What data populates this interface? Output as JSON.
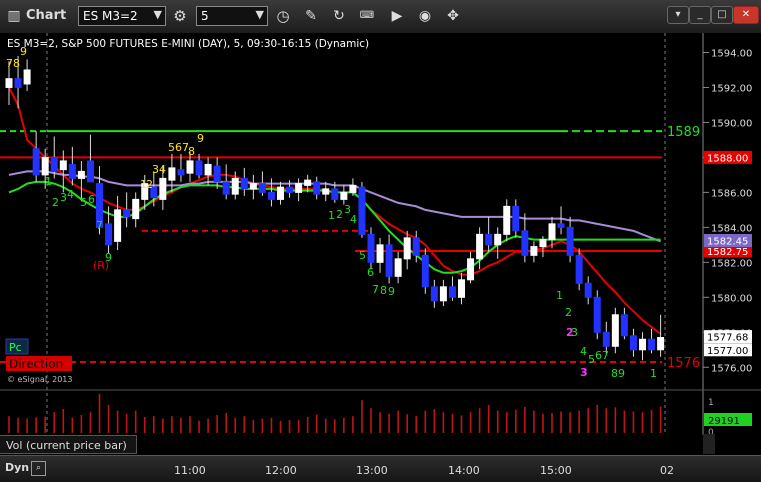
{
  "app": {
    "title": "Chart",
    "symbol": "ES M3=2",
    "interval": "5"
  },
  "chart_title": "ES M3=2, S&P 500 FUTURES E-MINI (DAY), 5, 09:30-16:15 (Dynamic)",
  "copyright": "© eSignal, 2013",
  "price_axis": {
    "ticks": [
      "1594.00",
      "1592.00",
      "1590.00",
      "1588.00",
      "1586.00",
      "1584.00",
      "1582.00",
      "1580.00",
      "1578.00",
      "1576.00"
    ]
  },
  "price_badges": [
    {
      "label": "1588.00",
      "color": "#e60000",
      "value": 1588.0
    },
    {
      "label": "1582.75",
      "color": "#e60000",
      "value": 1582.65
    },
    {
      "label": "1582.45",
      "color": "#7b68c6",
      "value": 1583.25
    },
    {
      "label": "1577.68",
      "color": "#ffffff",
      "value": 1577.75
    },
    {
      "label": "1577.00",
      "color": "#ffffff",
      "value": 1577.0
    }
  ],
  "level_labels": [
    {
      "label": "1589",
      "color": "#22dd22",
      "value": 1589.5
    },
    {
      "label": "1576",
      "color": "#e60000",
      "value": 1576.3
    }
  ],
  "time_axis": {
    "ticks": [
      "11:00",
      "12:00",
      "13:00",
      "14:00",
      "15:00",
      "02"
    ]
  },
  "indicators": {
    "pc": "Pc",
    "direction": "Direction",
    "bottom_tag": "Dyn"
  },
  "counts": {
    "yellow": [
      "78",
      "9",
      "1",
      "2",
      "34",
      "567",
      "8",
      "9"
    ],
    "green": [
      "1",
      "2",
      "3",
      "4",
      "5",
      "6",
      "7",
      "8",
      "9",
      "1",
      "2",
      "3",
      "4",
      "5",
      "6",
      "7",
      "8",
      "9",
      "1",
      "2",
      "3",
      "4",
      "5",
      "6",
      "7",
      "8",
      "9",
      "1"
    ],
    "magenta": [
      "1",
      "2",
      "3"
    ],
    "red": [
      "(R)"
    ]
  },
  "volume": {
    "label": "Vol (current price bar)",
    "value_label": "29191",
    "axis_ticks": [
      "1",
      "0"
    ]
  },
  "chart_data": {
    "type": "candlestick",
    "title": "ES M3=2, S&P 500 FUTURES E-MINI (DAY), 5, 09:30-16:15 (Dynamic)",
    "y_range": [
      1575.5,
      1595.0
    ],
    "x_labels": [
      "11:00",
      "12:00",
      "13:00",
      "14:00",
      "15:00",
      "02"
    ],
    "candles": [
      {
        "o": 1592.0,
        "h": 1593.5,
        "l": 1591.0,
        "c": 1592.5
      },
      {
        "o": 1592.5,
        "h": 1593.8,
        "l": 1590.8,
        "c": 1592.0
      },
      {
        "o": 1592.2,
        "h": 1593.6,
        "l": 1591.8,
        "c": 1593.0
      },
      {
        "o": 1588.5,
        "h": 1589.5,
        "l": 1586.6,
        "c": 1587.0
      },
      {
        "o": 1587.0,
        "h": 1588.5,
        "l": 1586.2,
        "c": 1588.0
      },
      {
        "o": 1588.0,
        "h": 1589.2,
        "l": 1586.8,
        "c": 1587.2
      },
      {
        "o": 1587.3,
        "h": 1588.4,
        "l": 1586.0,
        "c": 1587.8
      },
      {
        "o": 1587.6,
        "h": 1588.6,
        "l": 1586.4,
        "c": 1586.8
      },
      {
        "o": 1586.8,
        "h": 1587.8,
        "l": 1585.5,
        "c": 1587.2
      },
      {
        "o": 1587.8,
        "h": 1589.3,
        "l": 1586.8,
        "c": 1586.6
      },
      {
        "o": 1586.5,
        "h": 1587.5,
        "l": 1583.6,
        "c": 1584.0
      },
      {
        "o": 1584.2,
        "h": 1585.2,
        "l": 1582.5,
        "c": 1583.0
      },
      {
        "o": 1583.2,
        "h": 1585.8,
        "l": 1582.7,
        "c": 1585.0
      },
      {
        "o": 1585.0,
        "h": 1586.0,
        "l": 1584.0,
        "c": 1584.6
      },
      {
        "o": 1584.5,
        "h": 1586.0,
        "l": 1584.0,
        "c": 1585.6
      },
      {
        "o": 1585.6,
        "h": 1587.0,
        "l": 1585.0,
        "c": 1586.5
      },
      {
        "o": 1586.3,
        "h": 1587.2,
        "l": 1585.2,
        "c": 1585.7
      },
      {
        "o": 1585.6,
        "h": 1587.5,
        "l": 1585.0,
        "c": 1586.8
      },
      {
        "o": 1586.7,
        "h": 1588.2,
        "l": 1586.0,
        "c": 1587.4
      },
      {
        "o": 1587.3,
        "h": 1588.2,
        "l": 1586.6,
        "c": 1587.0
      },
      {
        "o": 1587.1,
        "h": 1588.3,
        "l": 1586.6,
        "c": 1587.8
      },
      {
        "o": 1587.8,
        "h": 1588.2,
        "l": 1586.8,
        "c": 1587.0
      },
      {
        "o": 1587.0,
        "h": 1588.0,
        "l": 1586.4,
        "c": 1587.6
      },
      {
        "o": 1587.5,
        "h": 1588.0,
        "l": 1586.2,
        "c": 1586.6
      },
      {
        "o": 1586.6,
        "h": 1587.6,
        "l": 1585.6,
        "c": 1585.9
      },
      {
        "o": 1585.9,
        "h": 1587.2,
        "l": 1585.6,
        "c": 1586.8
      },
      {
        "o": 1586.8,
        "h": 1587.4,
        "l": 1585.8,
        "c": 1586.2
      },
      {
        "o": 1586.2,
        "h": 1587.0,
        "l": 1585.6,
        "c": 1586.5
      },
      {
        "o": 1586.5,
        "h": 1587.2,
        "l": 1585.8,
        "c": 1586.0
      },
      {
        "o": 1586.0,
        "h": 1586.8,
        "l": 1585.2,
        "c": 1585.6
      },
      {
        "o": 1585.6,
        "h": 1586.6,
        "l": 1585.3,
        "c": 1586.3
      },
      {
        "o": 1586.3,
        "h": 1586.7,
        "l": 1585.7,
        "c": 1586.0
      },
      {
        "o": 1586.0,
        "h": 1586.8,
        "l": 1585.5,
        "c": 1586.5
      },
      {
        "o": 1586.4,
        "h": 1587.0,
        "l": 1586.0,
        "c": 1586.7
      },
      {
        "o": 1586.6,
        "h": 1586.9,
        "l": 1585.6,
        "c": 1585.9
      },
      {
        "o": 1585.9,
        "h": 1586.6,
        "l": 1585.5,
        "c": 1586.2
      },
      {
        "o": 1586.2,
        "h": 1586.6,
        "l": 1585.4,
        "c": 1585.6
      },
      {
        "o": 1585.6,
        "h": 1586.4,
        "l": 1585.3,
        "c": 1586.0
      },
      {
        "o": 1586.0,
        "h": 1586.8,
        "l": 1585.8,
        "c": 1586.4
      },
      {
        "o": 1586.3,
        "h": 1586.6,
        "l": 1583.4,
        "c": 1583.6
      },
      {
        "o": 1583.6,
        "h": 1584.0,
        "l": 1581.6,
        "c": 1582.0
      },
      {
        "o": 1582.0,
        "h": 1583.4,
        "l": 1581.4,
        "c": 1583.0
      },
      {
        "o": 1583.0,
        "h": 1583.6,
        "l": 1580.8,
        "c": 1581.2
      },
      {
        "o": 1581.2,
        "h": 1582.6,
        "l": 1580.8,
        "c": 1582.2
      },
      {
        "o": 1582.2,
        "h": 1583.8,
        "l": 1581.6,
        "c": 1583.4
      },
      {
        "o": 1583.4,
        "h": 1583.8,
        "l": 1582.0,
        "c": 1582.4
      },
      {
        "o": 1582.4,
        "h": 1582.8,
        "l": 1580.2,
        "c": 1580.6
      },
      {
        "o": 1580.6,
        "h": 1581.0,
        "l": 1579.4,
        "c": 1579.8
      },
      {
        "o": 1579.8,
        "h": 1581.0,
        "l": 1579.5,
        "c": 1580.6
      },
      {
        "o": 1580.6,
        "h": 1581.2,
        "l": 1579.8,
        "c": 1580.0
      },
      {
        "o": 1580.0,
        "h": 1581.4,
        "l": 1579.6,
        "c": 1581.0
      },
      {
        "o": 1581.0,
        "h": 1582.6,
        "l": 1580.8,
        "c": 1582.2
      },
      {
        "o": 1582.2,
        "h": 1584.0,
        "l": 1581.6,
        "c": 1583.6
      },
      {
        "o": 1583.6,
        "h": 1584.6,
        "l": 1582.6,
        "c": 1583.0
      },
      {
        "o": 1583.0,
        "h": 1584.0,
        "l": 1582.2,
        "c": 1583.6
      },
      {
        "o": 1583.6,
        "h": 1585.6,
        "l": 1583.2,
        "c": 1585.2
      },
      {
        "o": 1585.2,
        "h": 1585.6,
        "l": 1583.4,
        "c": 1583.8
      },
      {
        "o": 1583.8,
        "h": 1584.8,
        "l": 1582.0,
        "c": 1582.4
      },
      {
        "o": 1582.4,
        "h": 1583.2,
        "l": 1582.0,
        "c": 1582.9
      },
      {
        "o": 1582.9,
        "h": 1583.5,
        "l": 1582.3,
        "c": 1583.3
      },
      {
        "o": 1583.3,
        "h": 1584.6,
        "l": 1582.8,
        "c": 1584.2
      },
      {
        "o": 1584.2,
        "h": 1585.2,
        "l": 1583.6,
        "c": 1584.0
      },
      {
        "o": 1584.0,
        "h": 1584.6,
        "l": 1582.0,
        "c": 1582.4
      },
      {
        "o": 1582.4,
        "h": 1582.8,
        "l": 1580.4,
        "c": 1580.8
      },
      {
        "o": 1580.8,
        "h": 1581.2,
        "l": 1579.6,
        "c": 1580.0
      },
      {
        "o": 1580.0,
        "h": 1580.4,
        "l": 1577.6,
        "c": 1578.0
      },
      {
        "o": 1578.0,
        "h": 1578.6,
        "l": 1576.8,
        "c": 1577.2
      },
      {
        "o": 1577.2,
        "h": 1579.4,
        "l": 1576.8,
        "c": 1579.0
      },
      {
        "o": 1579.0,
        "h": 1579.4,
        "l": 1577.6,
        "c": 1577.8
      },
      {
        "o": 1577.8,
        "h": 1578.2,
        "l": 1576.6,
        "c": 1577.0
      },
      {
        "o": 1577.0,
        "h": 1578.0,
        "l": 1576.4,
        "c": 1577.6
      },
      {
        "o": 1577.6,
        "h": 1578.2,
        "l": 1576.8,
        "c": 1577.0
      },
      {
        "o": 1577.0,
        "h": 1579.0,
        "l": 1576.6,
        "c": 1577.7
      }
    ],
    "lines": [
      {
        "color": "#e60000",
        "values": [
          1592.0,
          1591.0,
          1589.0,
          1588.5,
          1588.0,
          1587.5,
          1587.0,
          1586.5,
          1586.2,
          1586.0,
          1585.7,
          1585.4,
          1585.2,
          1585.0,
          1585.0,
          1585.2,
          1585.5,
          1585.8,
          1586.0,
          1586.3,
          1586.5,
          1586.7,
          1586.9,
          1587.0,
          1587.0,
          1586.9,
          1586.7,
          1586.5,
          1586.4,
          1586.3,
          1586.2,
          1586.2,
          1586.2,
          1586.2,
          1586.2,
          1586.1,
          1586.0,
          1586.0,
          1586.0,
          1585.6,
          1585.0,
          1584.6,
          1584.2,
          1583.9,
          1583.6,
          1583.4,
          1583.0,
          1582.4,
          1581.8,
          1581.5,
          1581.3,
          1581.3,
          1581.5,
          1581.8,
          1582.0,
          1582.3,
          1582.6,
          1582.6,
          1582.7,
          1582.8,
          1583.0,
          1583.2,
          1583.0,
          1582.6,
          1582.0,
          1581.4,
          1580.8,
          1580.3,
          1579.7,
          1579.2,
          1578.7,
          1578.3,
          1577.9
        ]
      },
      {
        "color": "#a98bd8",
        "values": [
          1587.0,
          1587.1,
          1587.2,
          1587.2,
          1587.2,
          1587.1,
          1587.0,
          1587.0,
          1586.9,
          1586.9,
          1586.8,
          1586.6,
          1586.5,
          1586.4,
          1586.4,
          1586.4,
          1586.4,
          1586.4,
          1586.4,
          1586.4,
          1586.5,
          1586.5,
          1586.6,
          1586.6,
          1586.6,
          1586.6,
          1586.6,
          1586.5,
          1586.5,
          1586.5,
          1586.5,
          1586.5,
          1586.5,
          1586.5,
          1586.5,
          1586.5,
          1586.4,
          1586.4,
          1586.4,
          1586.2,
          1586.0,
          1585.8,
          1585.6,
          1585.4,
          1585.3,
          1585.2,
          1585.0,
          1584.9,
          1584.8,
          1584.7,
          1584.6,
          1584.6,
          1584.6,
          1584.6,
          1584.6,
          1584.6,
          1584.6,
          1584.5,
          1584.5,
          1584.5,
          1584.5,
          1584.5,
          1584.4,
          1584.4,
          1584.3,
          1584.2,
          1584.1,
          1584.0,
          1583.9,
          1583.8,
          1583.6,
          1583.4,
          1583.2
        ]
      },
      {
        "color": "#22dd22",
        "values": [
          1586.0,
          1586.2,
          1586.5,
          1586.6,
          1586.6,
          1586.5,
          1586.3,
          1586.0,
          1585.6,
          1585.3,
          1585.0,
          1584.8,
          1584.6,
          1584.6,
          1584.8,
          1585.2,
          1585.6,
          1585.9,
          1586.1,
          1586.3,
          1586.4,
          1586.4,
          1586.4,
          1586.4,
          1586.3,
          1586.3,
          1586.2,
          1586.2,
          1586.2,
          1586.2,
          1586.1,
          1586.1,
          1586.1,
          1586.1,
          1586.1,
          1586.1,
          1586.0,
          1586.0,
          1586.0,
          1585.6,
          1585.0,
          1584.4,
          1583.8,
          1583.3,
          1582.8,
          1582.4,
          1582.0,
          1581.6,
          1581.4,
          1581.4,
          1581.5,
          1581.7,
          1582.1,
          1582.6,
          1583.0,
          1583.3,
          1583.5,
          1583.4,
          1583.3,
          1583.3,
          1583.3,
          1583.3,
          1583.3,
          1583.3,
          1583.3,
          1583.3,
          1583.3,
          1583.3,
          1583.3,
          1583.3,
          1583.3,
          1583.3,
          1583.3
        ]
      }
    ],
    "levels": [
      {
        "value": 1589.5,
        "color": "#22dd22",
        "style": "dashed-then-solid"
      },
      {
        "value": 1588.0,
        "color": "#e60000",
        "style": "solid"
      },
      {
        "value": 1583.8,
        "color": "#e60000",
        "style": "dashed"
      },
      {
        "value": 1582.65,
        "color": "#e60000",
        "style": "solid"
      },
      {
        "value": 1576.3,
        "color": "#e60000",
        "style": "dashed"
      }
    ],
    "volume": [
      420,
      380,
      360,
      390,
      410,
      520,
      600,
      380,
      450,
      520,
      980,
      700,
      560,
      480,
      560,
      400,
      420,
      360,
      420,
      380,
      420,
      310,
      360,
      450,
      500,
      380,
      420,
      330,
      360,
      380,
      300,
      320,
      330,
      400,
      460,
      360,
      340,
      380,
      420,
      820,
      620,
      520,
      480,
      560,
      470,
      420,
      560,
      600,
      520,
      480,
      440,
      520,
      620,
      700,
      560,
      520,
      580,
      650,
      560,
      480,
      500,
      540,
      520,
      560,
      620,
      700,
      620,
      640,
      560,
      540,
      520,
      580,
      660
    ]
  }
}
